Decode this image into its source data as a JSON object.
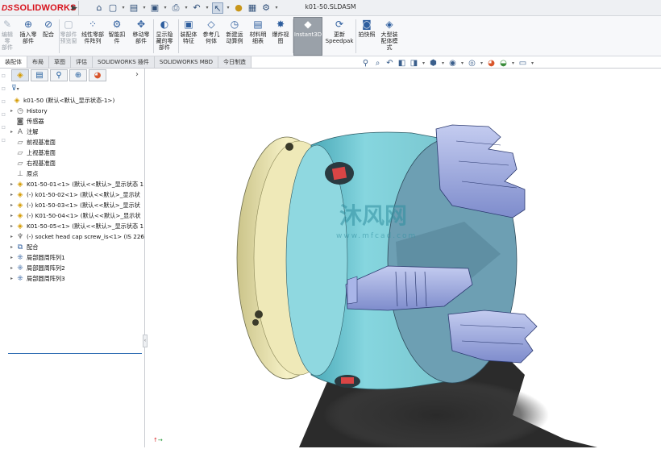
{
  "app": {
    "brand_ds": "DS",
    "brand_name": "SOLIDWORKS",
    "document_title": "k01-50.SLDASM"
  },
  "quick_access": [
    "home-icon",
    "new-icon",
    "open-icon",
    "save-icon",
    "print-icon",
    "undo-icon",
    "select-icon",
    "rebuild-icon",
    "file-properties-icon",
    "options-icon"
  ],
  "commands": [
    {
      "label": "编辑零\n部件",
      "icon": "edit-component-icon",
      "enabled": false
    },
    {
      "label": "插入零\n部件",
      "icon": "insert-component-icon",
      "enabled": true
    },
    {
      "label": "配合",
      "icon": "mate-icon",
      "enabled": true
    },
    {
      "label": "零部件\n预览窗",
      "icon": "component-preview-icon",
      "enabled": false
    },
    {
      "label": "线性零部\n件阵列",
      "icon": "linear-pattern-icon",
      "enabled": true
    },
    {
      "label": "智能扣\n件",
      "icon": "smart-fastener-icon",
      "enabled": true
    },
    {
      "label": "移动零\n部件",
      "icon": "move-component-icon",
      "enabled": true
    },
    {
      "label": "显示隐\n藏的零\n部件",
      "icon": "show-hidden-icon",
      "enabled": true
    },
    {
      "label": "装配体\n特征",
      "icon": "assembly-feature-icon",
      "enabled": true
    },
    {
      "label": "参考几\n何体",
      "icon": "reference-geometry-icon",
      "enabled": true
    },
    {
      "label": "新建运\n动算例",
      "icon": "motion-study-icon",
      "enabled": true
    },
    {
      "label": "材料明\n细表",
      "icon": "bom-icon",
      "enabled": true
    },
    {
      "label": "爆炸视\n图",
      "icon": "exploded-view-icon",
      "enabled": true
    },
    {
      "label": "Instant3D",
      "icon": "instant3d-icon",
      "enabled": true,
      "active": true
    },
    {
      "label": "更新\nSpeedpak",
      "icon": "speedpak-icon",
      "enabled": true
    },
    {
      "label": "拍快照",
      "icon": "snapshot-icon",
      "enabled": true
    },
    {
      "label": "大型装\n配体模\n式",
      "icon": "large-assembly-icon",
      "enabled": true
    }
  ],
  "tabs": [
    "装配体",
    "布局",
    "草图",
    "评估",
    "SOLIDWORKS 插件",
    "SOLIDWORKS MBD",
    "今日制造"
  ],
  "heads_up_icons": [
    "zoom-fit-icon",
    "zoom-area-icon",
    "previous-view-icon",
    "section-view-icon",
    "dynamic-annotation-icon",
    "view-orientation-icon",
    "display-style-icon",
    "hide-show-icon",
    "appearance-icon",
    "scene-icon",
    "view-settings-icon"
  ],
  "feature_tree": [
    {
      "label": "k01-50  (默认<默认_显示状态-1>)",
      "icon": "assembly-icon",
      "expander": ""
    },
    {
      "label": "History",
      "icon": "history-icon",
      "expander": "▸"
    },
    {
      "label": "传感器",
      "icon": "sensor-icon",
      "expander": ""
    },
    {
      "label": "注解",
      "icon": "annotation-icon",
      "expander": "▸"
    },
    {
      "label": "前视基准面",
      "icon": "plane-icon",
      "expander": ""
    },
    {
      "label": "上视基准面",
      "icon": "plane-icon",
      "expander": ""
    },
    {
      "label": "右视基准面",
      "icon": "plane-icon",
      "expander": ""
    },
    {
      "label": "原点",
      "icon": "origin-icon",
      "expander": ""
    },
    {
      "label": "K01-50-01<1> (默认<<默认>_显示状态 1",
      "icon": "part-icon",
      "expander": "▸"
    },
    {
      "label": "(-) k01-50-02<1> (默认<<默认>_显示状",
      "icon": "part-icon",
      "expander": "▸"
    },
    {
      "label": "(-) k01-50-03<1> (默认<<默认>_显示状",
      "icon": "part-icon",
      "expander": "▸"
    },
    {
      "label": "(-) K01-50-04<1> (默认<<默认>_显示状",
      "icon": "part-icon",
      "expander": "▸"
    },
    {
      "label": "K01-50-05<1> (默认<<默认>_显示状态 1",
      "icon": "part-icon",
      "expander": "▸"
    },
    {
      "label": "(-) socket head cap screw_is<1> (IS 226",
      "icon": "screw-icon",
      "expander": "▸"
    },
    {
      "label": "配合",
      "icon": "mates-folder-icon",
      "expander": "▸"
    },
    {
      "label": "局部圆周阵列1",
      "icon": "circular-pattern-icon",
      "expander": "▸"
    },
    {
      "label": "局部圆周阵列2",
      "icon": "circular-pattern-icon",
      "expander": "▸"
    },
    {
      "label": "局部圆周阵列3",
      "icon": "circular-pattern-icon",
      "expander": "▸"
    }
  ],
  "watermark": {
    "title": "沐风网",
    "url": "www.mfcad.com"
  },
  "colors": {
    "brand_red": "#d8111b",
    "chuck_body": "#7ccfd8",
    "chuck_face": "#6b9fb5",
    "flange": "#efe9b8",
    "jaw": "#9aa8e0",
    "square_socket": "#d84545"
  }
}
